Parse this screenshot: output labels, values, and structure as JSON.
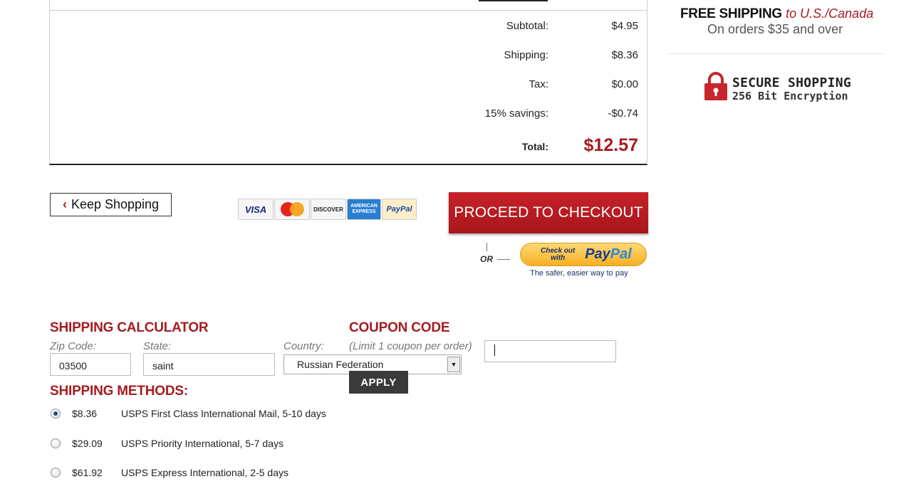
{
  "summary": {
    "rows": [
      {
        "label": "Subtotal:",
        "value": "$4.95"
      },
      {
        "label": "Shipping:",
        "value": "$8.36"
      },
      {
        "label": "Tax:",
        "value": "$0.00"
      },
      {
        "label": "15% savings:",
        "value": "-$0.74"
      }
    ],
    "total_label": "Total:",
    "total_value": "$12.57"
  },
  "actions": {
    "keep_shopping": "Keep Shopping",
    "checkout": "PROCEED TO CHECKOUT",
    "or": "OR",
    "paypal_small": "Check out with",
    "paypal_big_1": "Pay",
    "paypal_big_2": "Pal",
    "paypal_tagline": "The safer, easier way to pay"
  },
  "cards": {
    "visa": "VISA",
    "discover": "DISCOVER",
    "amex": "AMERICAN EXPRESS",
    "paypal": "PayPal"
  },
  "promo": {
    "free_shipping": "FREE SHIPPING",
    "free_shipping_region": "to U.S./Canada",
    "free_shipping_sub": "On orders $35 and over",
    "secure_title": "SECURE SHOPPING",
    "secure_sub": "256 Bit Encryption"
  },
  "calculator": {
    "title": "SHIPPING CALCULATOR",
    "zip_label": "Zip Code:",
    "zip_value": "03500",
    "state_label": "State:",
    "state_value": "saint",
    "country_label": "Country:",
    "country_value": "Russian Federation"
  },
  "coupon": {
    "title": "COUPON CODE",
    "note": "(Limit 1 coupon per order)",
    "value": "",
    "apply": "APPLY"
  },
  "methods": {
    "title": "SHIPPING METHODS:",
    "items": [
      {
        "price": "$8.36",
        "desc": "USPS First Class International Mail, 5-10 days",
        "selected": true
      },
      {
        "price": "$29.09",
        "desc": "USPS Priority International, 5-7 days",
        "selected": false
      },
      {
        "price": "$61.92",
        "desc": "USPS Express International, 2-5 days",
        "selected": false
      }
    ]
  },
  "colors": {
    "accent_red": "#a51c22",
    "dark_button": "#3a3a3a"
  }
}
